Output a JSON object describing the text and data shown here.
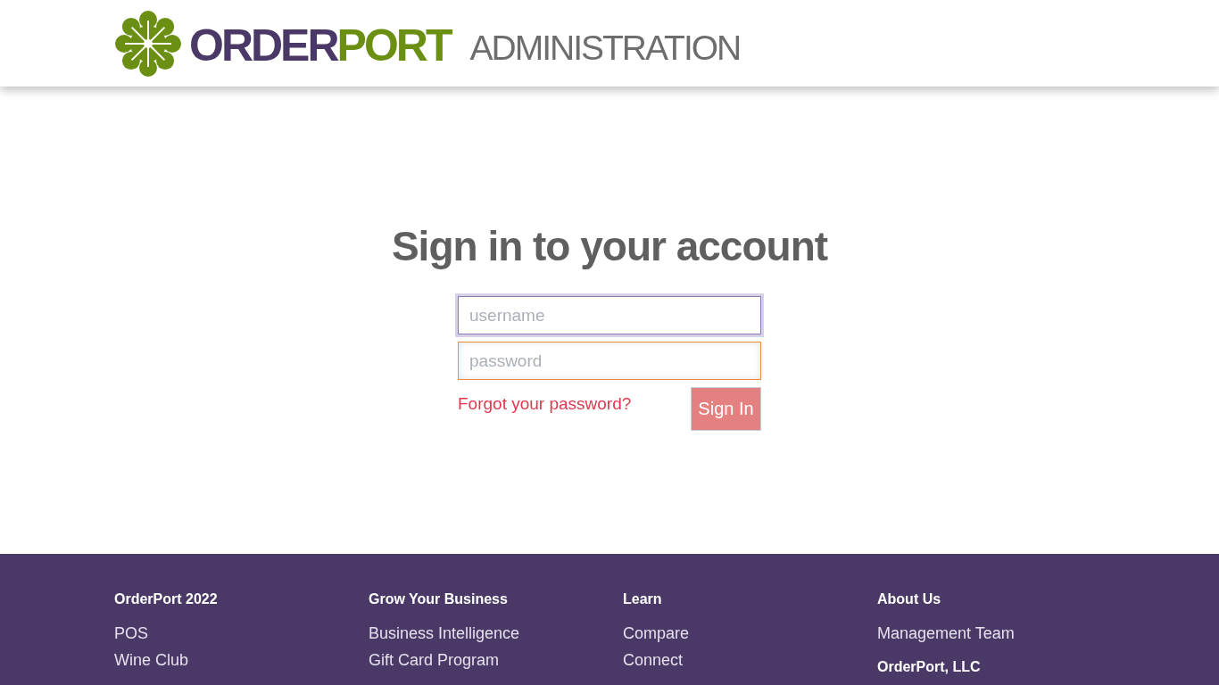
{
  "header": {
    "brand_parts": [
      "ORDER",
      "PORT"
    ],
    "subtitle": "ADMINISTRATION"
  },
  "login": {
    "title": "Sign in to your account",
    "fields": [
      {
        "placeholder": "username",
        "focused": true
      },
      {
        "placeholder": "password",
        "focused": false
      }
    ],
    "forgot_link": "Forgot your password?",
    "submit_button": "Sign In"
  },
  "footer": {
    "columns": [
      {
        "heading": "OrderPort 2022",
        "links": [
          "POS",
          "Wine Club"
        ]
      },
      {
        "heading": "Grow Your Business",
        "links": [
          "Business Intelligence",
          "Gift Card Program"
        ]
      },
      {
        "heading": "Learn",
        "links": [
          "Compare",
          "Connect"
        ]
      },
      {
        "heading": "About Us",
        "links": [
          "Management Team"
        ],
        "subheading": "OrderPort, LLC"
      }
    ]
  }
}
